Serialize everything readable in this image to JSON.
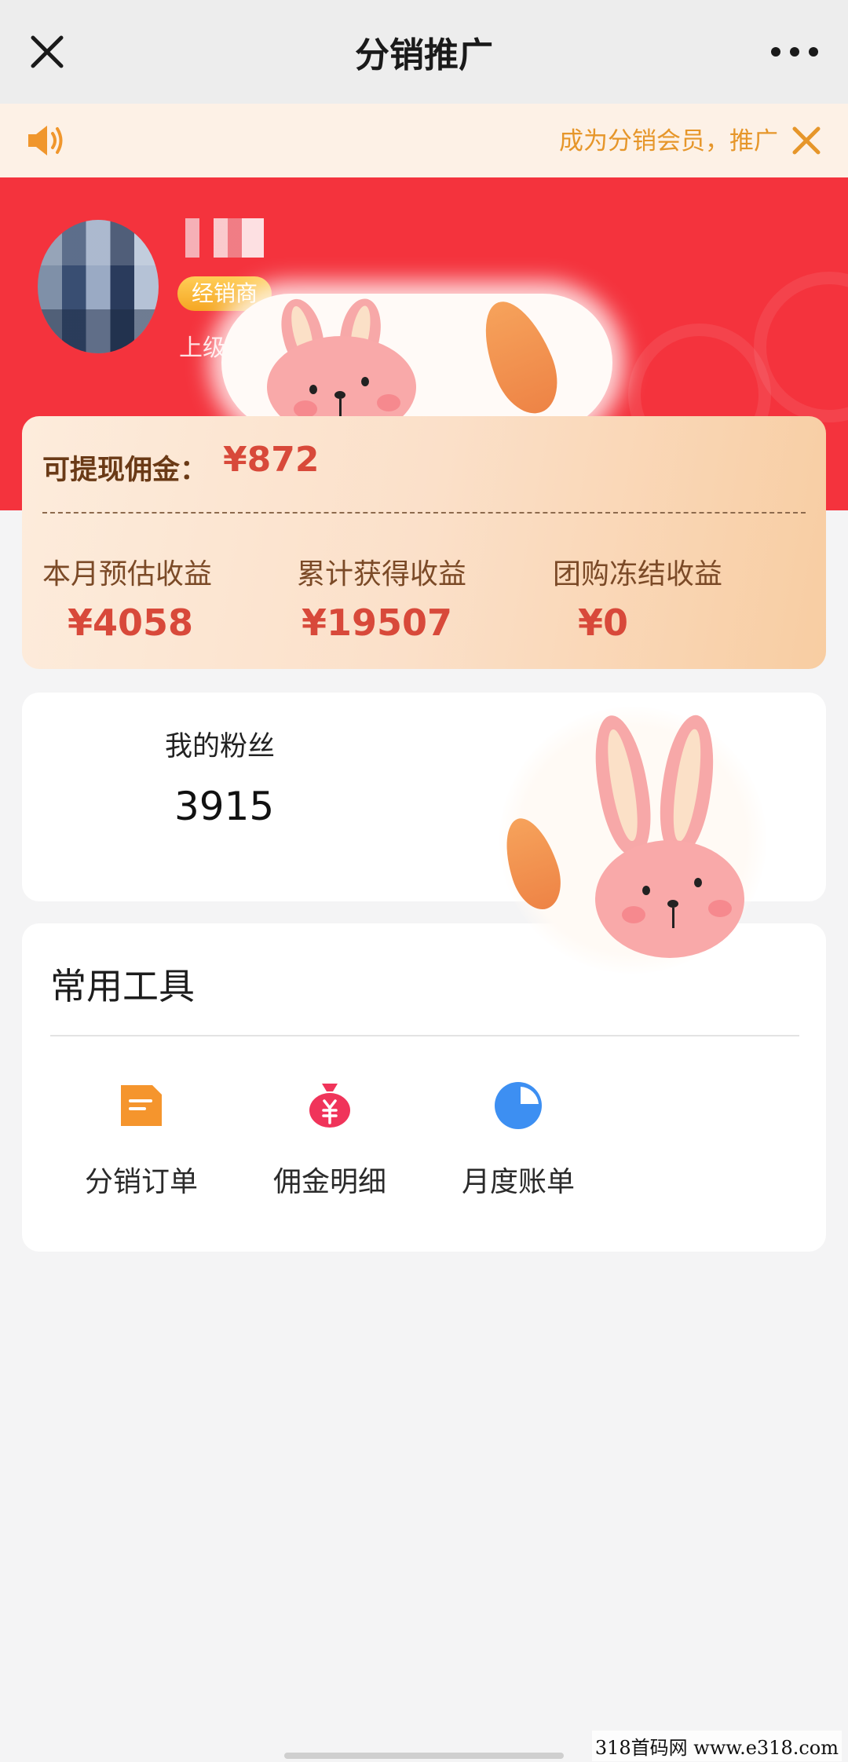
{
  "nav": {
    "title": "分销推广",
    "close_icon": "close-icon",
    "more_icon": "more-dots-icon"
  },
  "notice": {
    "text": "成为分销会员，推广",
    "speaker_icon": "speaker-icon",
    "close_icon": "close-icon"
  },
  "profile": {
    "badge": "经销商",
    "upline_label": "上级"
  },
  "earnings": {
    "withdrawable_label": "可提现佣金：",
    "withdrawable_value": "¥872",
    "stats": [
      {
        "label": "本月预估收益",
        "value": "¥4058"
      },
      {
        "label": "累计获得收益",
        "value": "¥19507"
      },
      {
        "label": "团购冻结收益",
        "value": "¥0"
      }
    ]
  },
  "fans": {
    "label": "我的粉丝",
    "value": "3915"
  },
  "tools": {
    "title": "常用工具",
    "items": [
      {
        "label": "分销订单",
        "icon": "document-icon",
        "color": "#f5952d"
      },
      {
        "label": "佣金明细",
        "icon": "money-bag-icon",
        "color": "#f0345a"
      },
      {
        "label": "月度账单",
        "icon": "pie-chart-icon",
        "color": "#3d8ff2"
      }
    ]
  },
  "colors": {
    "brand_red": "#f4333d",
    "accent_orange": "#e6962a",
    "amount_red": "#d8493a"
  },
  "watermark": "318首码网 www.e318.com"
}
